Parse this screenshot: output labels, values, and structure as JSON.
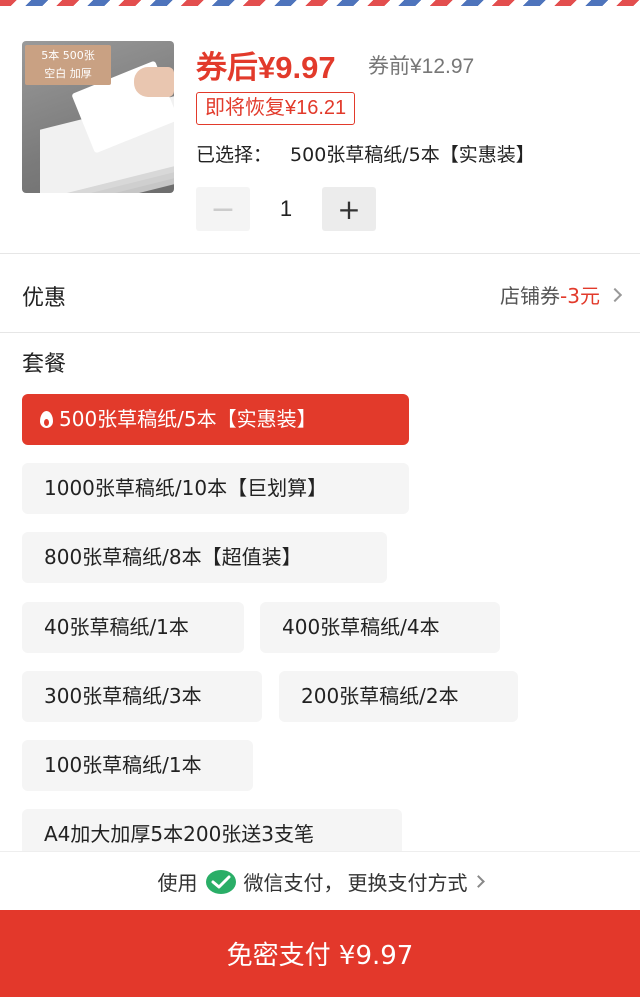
{
  "product": {
    "image_badge_line1": "5本 500张",
    "image_badge_line2": "空白 加厚",
    "price_after_coupon": "券后¥9.97",
    "price_before_coupon": "券前¥12.97",
    "restore_notice": "即将恢复¥16.21",
    "selected_label": "已选择：",
    "selected_value": "500张草稿纸/5本【实惠装】",
    "quantity": "1",
    "minus_symbol": "−",
    "plus_symbol": "+"
  },
  "discount": {
    "label": "优惠",
    "coupon_prefix": "店铺券",
    "coupon_amount": "-3元"
  },
  "package": {
    "label": "套餐",
    "options": [
      "500张草稿纸/5本【实惠装】",
      "1000张草稿纸/10本【巨划算】",
      "800张草稿纸/8本【超值装】",
      "40张草稿纸/1本",
      "400张草稿纸/4本",
      "300张草稿纸/3本",
      "200张草稿纸/2本",
      "100张草稿纸/1本",
      "A4加大加厚5本200张送3支笔"
    ],
    "selected_index": 0
  },
  "payment": {
    "use_label": "使用",
    "method": "微信支付，",
    "change_label": "更换支付方式",
    "submit_label": "免密支付 ¥9.97"
  },
  "colors": {
    "accent": "#e23a2b",
    "wechat_green": "#2aae67"
  }
}
